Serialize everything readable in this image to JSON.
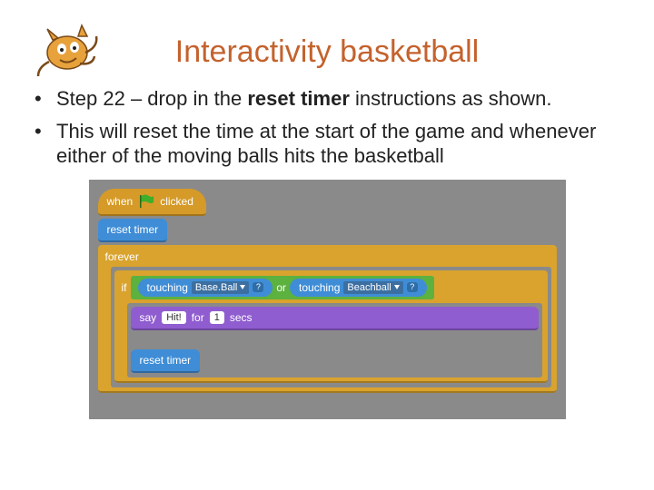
{
  "title": "Interactivity basketball",
  "bullets": {
    "b1_prefix": "Step 22 – drop in the ",
    "b1_bold": "reset timer",
    "b1_suffix": " instructions as shown.",
    "b2": "This will reset the time at the start of the game and whenever either of the moving balls hits the basketball"
  },
  "code": {
    "hat_when": "when",
    "hat_clicked": "clicked",
    "reset_timer": "reset timer",
    "forever": "forever",
    "if": "if",
    "touching": "touching",
    "sprite1": "Base.Ball",
    "qmark": "?",
    "or": "or",
    "sprite2": "Beachball",
    "say": "say",
    "say_msg": "Hit!",
    "for": "for",
    "secs_num": "1",
    "secs": "secs",
    "reset_timer2": "reset timer"
  }
}
